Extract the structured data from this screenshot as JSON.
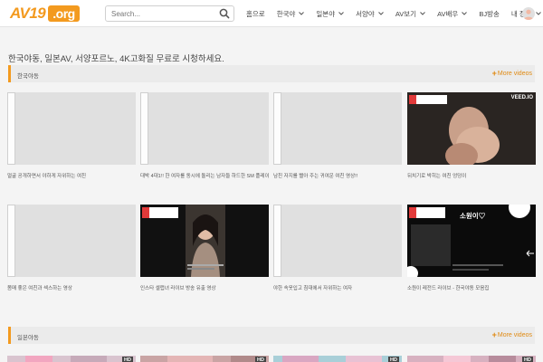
{
  "header": {
    "logo_main": "AV19",
    "logo_tld": ".org",
    "search_placeholder": "Search...",
    "nav": [
      {
        "label": "홈으로",
        "dropdown": false
      },
      {
        "label": "한국야",
        "dropdown": true
      },
      {
        "label": "일본야",
        "dropdown": true
      },
      {
        "label": "서양야",
        "dropdown": true
      },
      {
        "label": "AV보기",
        "dropdown": true
      },
      {
        "label": "AV배우",
        "dropdown": true
      },
      {
        "label": "BJ방송",
        "dropdown": false
      },
      {
        "label": "내 정보",
        "dropdown": true
      }
    ]
  },
  "tagline": "한국야동, 일본AV, 서양포르노, 4K고화질 무료로 시청하세요.",
  "sections": [
    {
      "title": "한국야동",
      "more": "More videos"
    },
    {
      "title": "일본야동",
      "more": "More videos"
    }
  ],
  "videos_row1": [
    {
      "title": "얼굴 공개하면서 야하게 자위하는 여친",
      "thumb": "broken"
    },
    {
      "title": "대박 4대1!! 한 여자를 동시에 돌리는 남자들 하드한 SM 플레이 영상",
      "thumb": "broken"
    },
    {
      "title": "남친 자지를 빨아 주는 귀여운 여친 영상!!",
      "thumb": "broken"
    },
    {
      "title": "뒤치기로 박히는 여친 엉덩이",
      "thumb": "image",
      "watermark": "VEED.IO"
    }
  ],
  "videos_row2": [
    {
      "title": "몸매 좋은 여친과 섹스하는 영상",
      "thumb": "broken"
    },
    {
      "title": "인스타 셀럽녀 라이브 방송 유출 영상",
      "thumb": "image"
    },
    {
      "title": "야한 속옷입고 침대에서 자위하는 여자",
      "thumb": "broken"
    },
    {
      "title": "소원이 레전드 라이브 - 한국야동 모음집",
      "thumb": "image",
      "caption": "소원이♡"
    }
  ],
  "badges": {
    "hd": "HD"
  },
  "colors": {
    "accent": "#f39a1f",
    "bg": "#f4f4f4"
  }
}
